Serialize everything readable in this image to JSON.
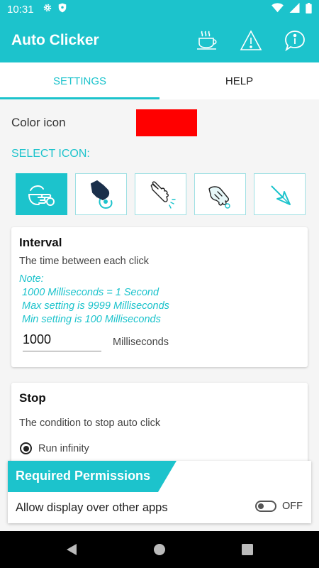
{
  "status_bar": {
    "time": "10:31"
  },
  "app_bar": {
    "title": "Auto Clicker"
  },
  "tabs": [
    {
      "label": "SETTINGS",
      "active": true
    },
    {
      "label": "HELP",
      "active": false
    }
  ],
  "settings": {
    "color_label": "Color icon",
    "color_value": "#ff0000",
    "select_icon_label": "SELECT ICON:",
    "icons": [
      "tap-hand-icon",
      "press-hand-icon",
      "click-hand-icon",
      "point-hand-icon",
      "arrow-cursor-icon"
    ],
    "selected_icon_index": 0
  },
  "interval": {
    "title": "Interval",
    "description": "The time between each click",
    "note_title": "Note:",
    "note_lines": [
      "1000 Milliseconds = 1 Second",
      "Max setting is 9999 Milliseconds",
      "Min setting is 100 Milliseconds"
    ],
    "value": "1000",
    "unit": "Milliseconds"
  },
  "stop": {
    "title": "Stop",
    "description": "The condition to stop auto click",
    "option_label": "Run infinity"
  },
  "permissions": {
    "title": "Required Permissions",
    "item_label": "Allow display over other apps",
    "toggle_state": "OFF"
  },
  "colors": {
    "accent": "#1cc3cc"
  }
}
